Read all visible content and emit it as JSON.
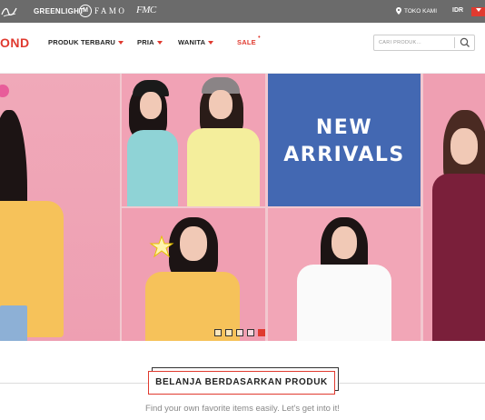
{
  "topbar": {
    "brands": [
      "GREENLIGHT",
      "FAMO",
      "FMC"
    ],
    "store_link": "TOKO KAMI",
    "currency": "IDR"
  },
  "header": {
    "logo": "OND",
    "nav": [
      {
        "label": "PRODUK TERBARU"
      },
      {
        "label": "PRIA"
      },
      {
        "label": "WANITA"
      },
      {
        "label": "SALE"
      }
    ],
    "search_placeholder": "CARI PRODUK..."
  },
  "hero": {
    "headline_line1": "NEW",
    "headline_line2": "ARRIVALS",
    "slides": 5,
    "active_slide": 5
  },
  "section": {
    "title": "BELANJA BERDASARKAN PRODUK",
    "subtitle": "Find your own favorite items easily. Let's get into it!"
  },
  "colors": {
    "accent": "#e03a2f",
    "topbar_bg": "#6b6b6b",
    "hero_pink": "#f1a2b5",
    "hero_blue": "#4368b2"
  }
}
